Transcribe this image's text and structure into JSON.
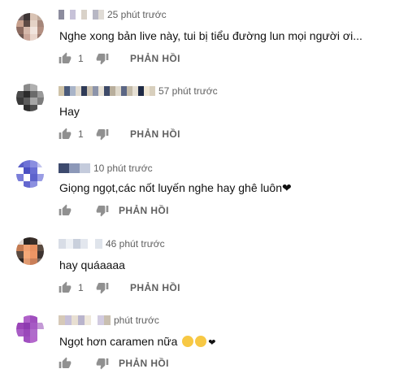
{
  "comments": [
    {
      "time": "25 phút trước",
      "text": "Nghe xong bản live này, tui bị tiểu đường lun mọi người ơi...",
      "likes": "1",
      "reply_label": "PHẢN HỒI",
      "avatar_colors": [
        "#7a6a6a",
        "#3d3535",
        "#d9c3b4",
        "#bfa99a",
        "#c8a08c",
        "#5e4a44",
        "#e4d2c6",
        "#a5867a",
        "#8c6b60",
        "#d6b8aa",
        "#f1e4dd",
        "#b38f81",
        "#6d5750",
        "#caa699",
        "#e9d5cb",
        "#9a7b70"
      ],
      "name_colors": [
        "#8c8c9e",
        "#ffffff",
        "#c7c2d8",
        "#ffffff",
        "#d9d2c8",
        "#ffffff",
        "#b7b7c4",
        "#e0dcd6"
      ]
    },
    {
      "time": "57 phút trước",
      "text": "Hay",
      "likes": "1",
      "reply_label": "PHẢN HỒI",
      "avatar_colors": [
        "#ffffff",
        "#8a8a8a",
        "#b0b0b0",
        "#ffffff",
        "#4a4a4a",
        "#2b2b2b",
        "#6a6a6a",
        "#9a9a9a",
        "#3a3a3a",
        "#5c5c5c",
        "#a6a6a6",
        "#7c7c7c",
        "#ffffff",
        "#2e2e2e",
        "#505050",
        "#ffffff"
      ],
      "name_colors": [
        "#cfc3a8",
        "#4a5a7a",
        "#a9b4c8",
        "#e1dbd0",
        "#2f3b57",
        "#c9c0b0",
        "#8c94aa",
        "#e8e2d6",
        "#3e4a68",
        "#b8ae9c",
        "#dfd9cc",
        "#5b6684",
        "#c4bba9",
        "#e6e0d4",
        "#1f2a45",
        "#f0e7d5",
        "#d8cfbd"
      ]
    },
    {
      "time": "10 phút trước",
      "text": "Giọng ngọt,các nốt luyến nghe hay ghê luôn❤",
      "likes": "",
      "reply_label": "PHẢN HỒI",
      "avatar_colors": [
        "#5a5fc8",
        "#6e72d6",
        "#8a8ee0",
        "#c3c5ef",
        "#ffffff",
        "#4b50c2",
        "#6a6fd4",
        "#ffffff",
        "#7a7ed9",
        "#ffffff",
        "#5e63cc",
        "#9a9de4",
        "#ffffff",
        "#6367cf",
        "#8c90e0",
        "#ffffff"
      ],
      "name_colors": [
        "#3d4a6e",
        "#8c98b8",
        "#c4cbdc"
      ]
    },
    {
      "time": "46 phút trước",
      "text": "hay quáaaaa",
      "likes": "1",
      "reply_label": "PHẢN HỒI",
      "avatar_colors": [
        "#e0d8d2",
        "#2a2522",
        "#3a2e28",
        "#e6ddd6",
        "#c47b52",
        "#f0a070",
        "#e89060",
        "#5a4a40",
        "#5a4a40",
        "#f3a878",
        "#ec9565",
        "#3d3330",
        "#2e2622",
        "#e09a70",
        "#c97e58",
        "#7a6a60"
      ],
      "name_colors": [
        "#d8dde6",
        "#eef1f5",
        "#c9d0dc",
        "#e3e7ee",
        "#ffffff",
        "#dfe4eb"
      ]
    },
    {
      "time": "phút trước",
      "text": "Ngọt hơn caramen nữa ",
      "likes": "",
      "reply_label": "PHẢN HỒI",
      "avatar_colors": [
        "#ffffff",
        "#b061c9",
        "#a04fbe",
        "#ffffff",
        "#9b45b8",
        "#8e3bb0",
        "#a65ac4",
        "#c49ad6",
        "#a85cc5",
        "#9a48ba",
        "#b06ccb",
        "#ffffff",
        "#ffffff",
        "#a050c0",
        "#b468cc",
        "#ffffff"
      ],
      "name_colors": [
        "#d6c9b8",
        "#c7c0d8",
        "#e8dfd2",
        "#b9b4cc",
        "#efe8dc",
        "#ffffff",
        "#d2cbe0",
        "#c9bfb0"
      ]
    }
  ]
}
